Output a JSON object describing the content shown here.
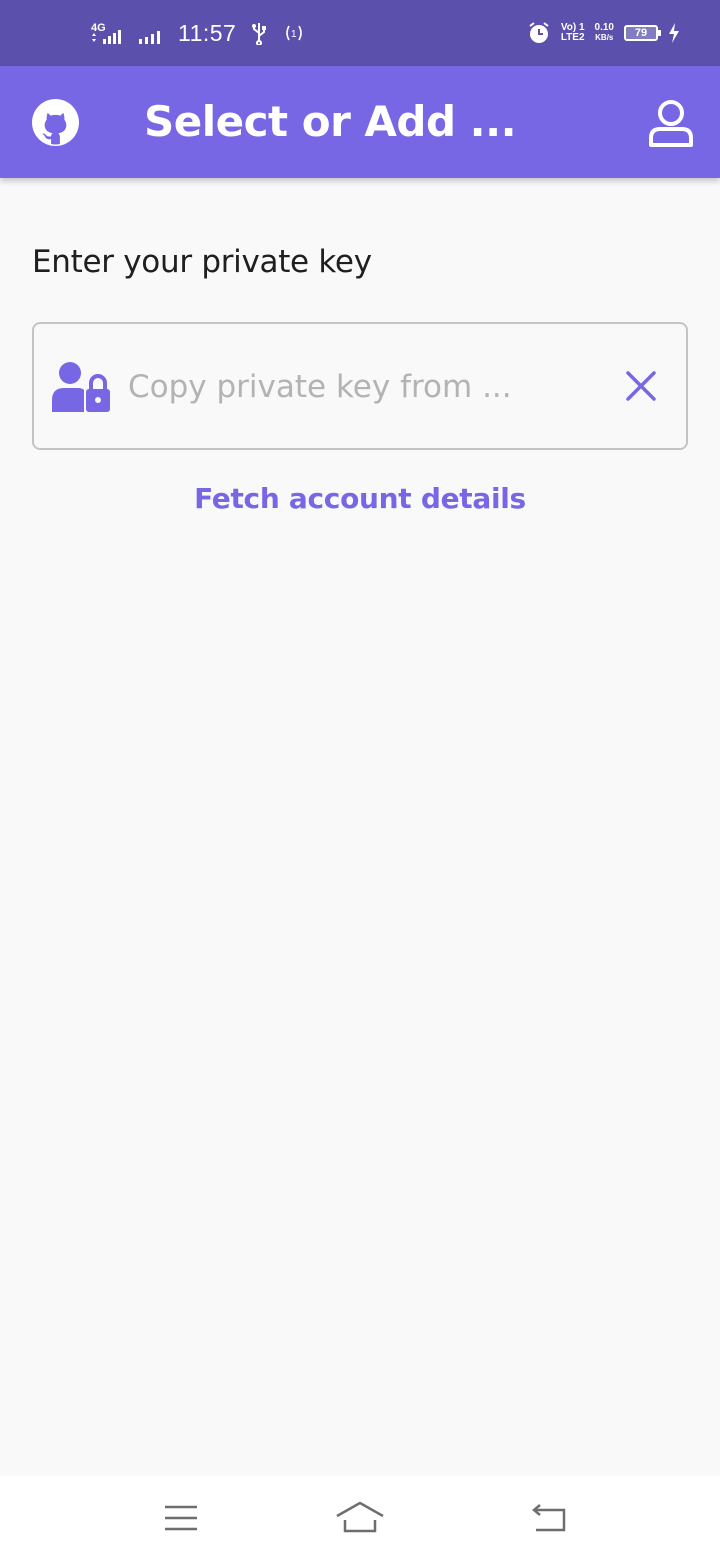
{
  "status_bar": {
    "time": "11:57",
    "network_left": "4G",
    "volte": "Vo) 1",
    "lte": "LTE2",
    "speed_value": "0.10",
    "speed_unit": "KB/s",
    "battery": "79"
  },
  "app_bar": {
    "title": "Select or Add ...",
    "left_icon": "github-icon",
    "right_icon": "user-icon"
  },
  "form": {
    "prompt": "Enter your private key",
    "key_input": {
      "value": "",
      "placeholder": "Copy private key from ..."
    },
    "fetch_label": "Fetch account details"
  },
  "colors": {
    "status_bar": "#5b51ad",
    "accent": "#7767e4",
    "background": "#f9f9f9"
  },
  "nav_icons": [
    "menu-icon",
    "home-icon",
    "back-icon"
  ]
}
